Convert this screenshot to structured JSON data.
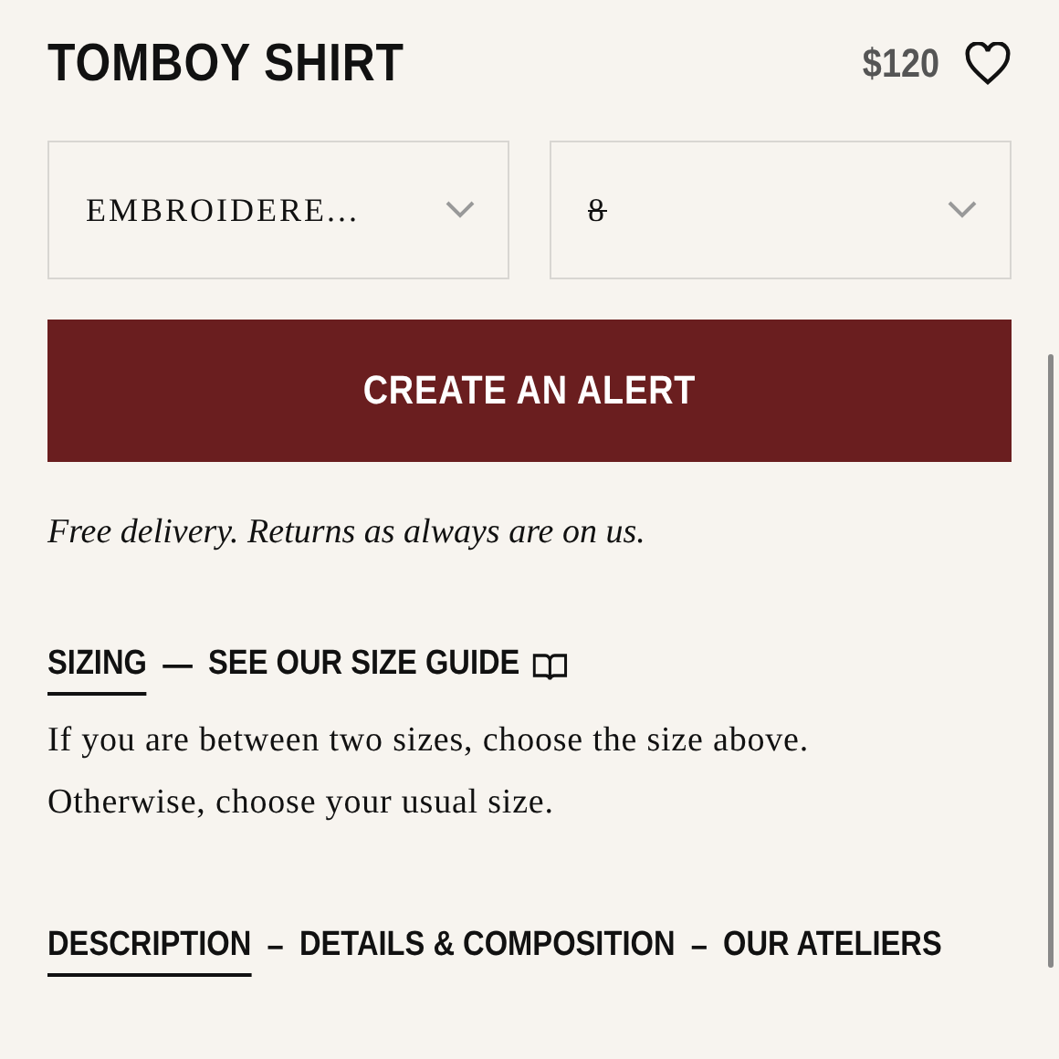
{
  "product": {
    "title": "TOMBOY SHIRT",
    "price": "$120",
    "favorite": false
  },
  "selects": [
    {
      "value": "EMBROIDERE...",
      "unavailable": false
    },
    {
      "value": "8",
      "unavailable": true
    }
  ],
  "action_button": "CREATE AN ALERT",
  "delivery_note": "Free delivery. Returns as always are on us.",
  "sections": [
    {
      "separator": "—",
      "tabs": [
        {
          "label": "SIZING",
          "selected": true,
          "kind": "tab"
        },
        {
          "label": "SEE OUR SIZE GUIDE",
          "selected": false,
          "kind": "guide"
        }
      ],
      "text": [
        "If you are between two sizes, choose the size above.",
        "Otherwise, choose your usual size."
      ]
    },
    {
      "separator": "–",
      "tabs": [
        {
          "label": "DESCRIPTION",
          "selected": true,
          "kind": "tab"
        },
        {
          "label": "DETAILS & COMPOSITION",
          "selected": false,
          "kind": "tab"
        },
        {
          "label": "OUR ATELIERS",
          "selected": false,
          "kind": "tab"
        }
      ]
    }
  ]
}
